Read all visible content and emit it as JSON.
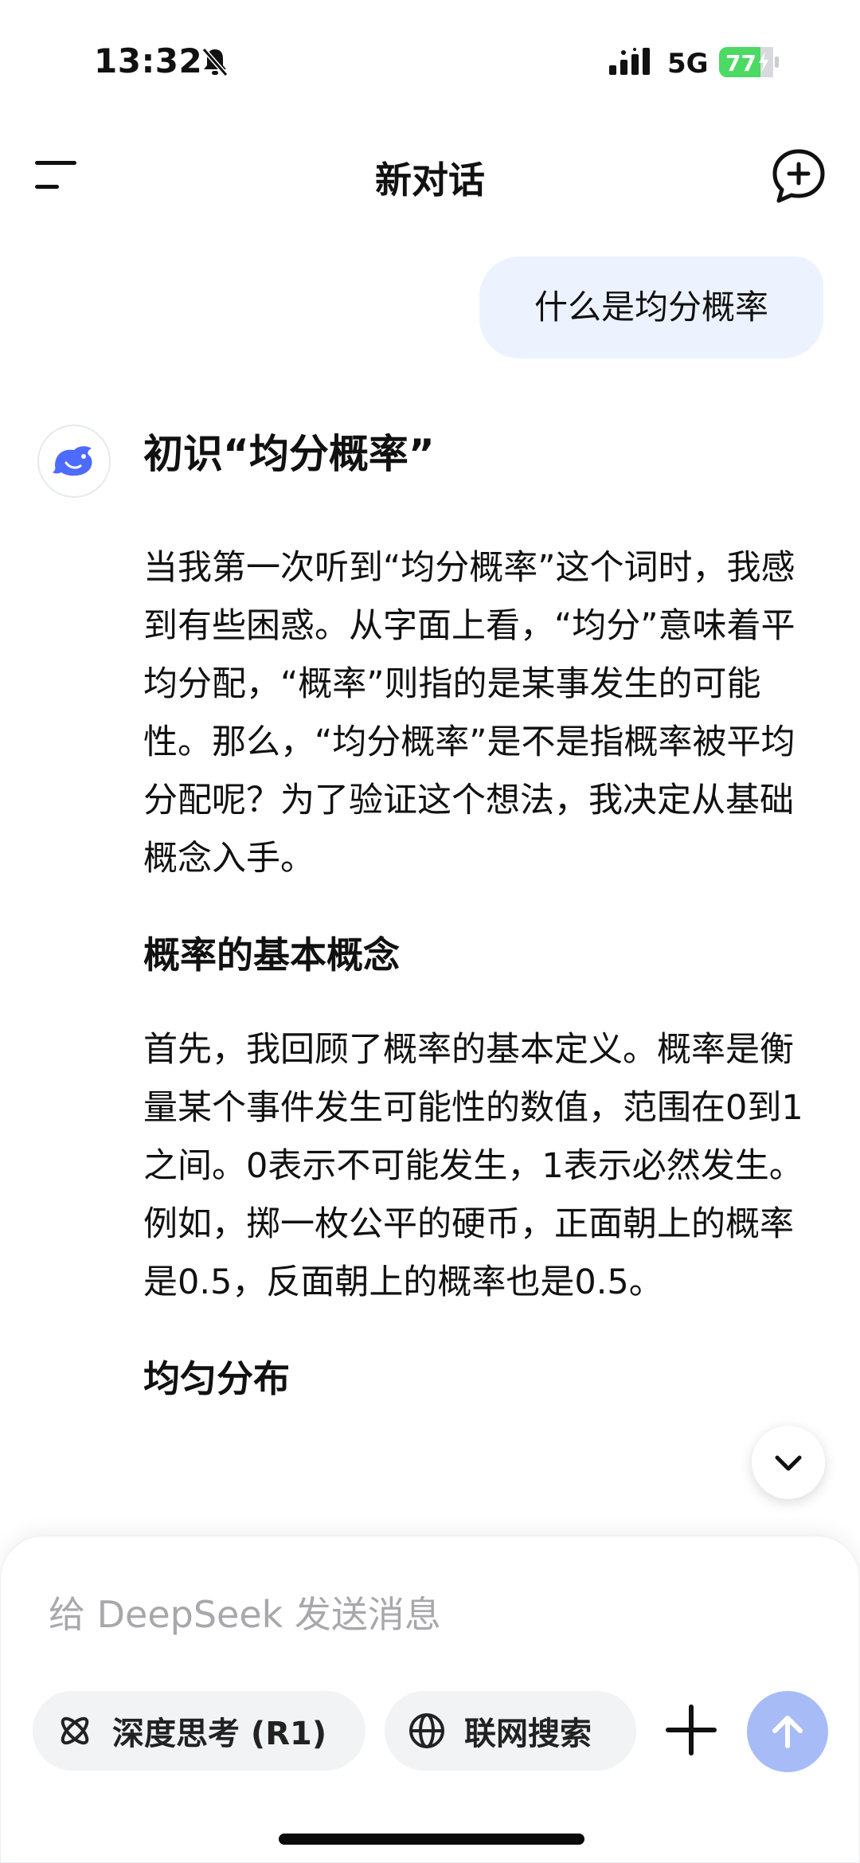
{
  "status_bar": {
    "time": "13:32",
    "network": "5G",
    "battery": "77"
  },
  "header": {
    "title": "新对话"
  },
  "conversation": {
    "user_message": "什么是均分概率",
    "assistant": {
      "heading": "初识“均分概率”",
      "paragraph_1": "当我第一次听到“均分概率”这个词时，我感到有些困惑。从字面上看，“均分”意味着平均分配，“概率”则指的是某事发生的可能性。那么，“均分概率”是不是指概率被平均分配呢？为了验证这个想法，我决定从基础概念入手。",
      "section_1_title": "概率的基本概念",
      "paragraph_2": "首先，我回顾了概率的基本定义。概率是衡量某个事件发生可能性的数值，范围在0到1之间。0表示不可能发生，1表示必然发生。例如，掷一枚公平的硬币，正面朝上的概率是0.5，反面朝上的概率也是0.5。",
      "section_2_title": "均匀分布"
    }
  },
  "composer": {
    "placeholder": "给 DeepSeek 发送消息",
    "deep_think_label": "深度思考 (R1)",
    "web_search_label": "联网搜索"
  },
  "colors": {
    "accent": "#4d6bfe",
    "send_disabled": "#a7bbf7",
    "user_bubble": "#edf3fe",
    "battery": "#4cd964"
  },
  "icons": [
    "bell-slash-icon",
    "signal-icon",
    "battery-icon",
    "menu-icon",
    "new-chat-icon",
    "deepseek-logo-icon",
    "chevron-down-icon",
    "atom-icon",
    "globe-icon",
    "plus-icon",
    "arrow-up-icon"
  ]
}
